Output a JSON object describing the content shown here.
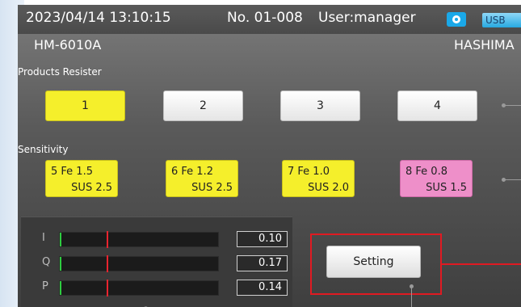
{
  "status_bar": {
    "datetime": "2023/04/14 13:10:15",
    "number": "No. 01-008",
    "user": "User:manager",
    "camera_icon": "camera-icon",
    "usb_label": "USB"
  },
  "header": {
    "model": "HM-6010A",
    "maker": "HASHIMA"
  },
  "products": {
    "title": "Products Resister",
    "buttons": [
      {
        "label": "1",
        "selected": true
      },
      {
        "label": "2",
        "selected": false
      },
      {
        "label": "3",
        "selected": false
      },
      {
        "label": "4",
        "selected": false
      }
    ]
  },
  "sensitivity": {
    "title": "Sensitivity",
    "items": [
      {
        "row1": "5  Fe   1.5",
        "row2": "SUS  2.5",
        "color": "#f5ef2b"
      },
      {
        "row1": "6  Fe   1.2",
        "row2": "SUS  2.5",
        "color": "#f5ef2b"
      },
      {
        "row1": "7  Fe   1.0",
        "row2": "SUS  2.0",
        "color": "#f5ef2b"
      },
      {
        "row1": "8  Fe   0.8",
        "row2": "SUS  1.5",
        "color": "#ee8fc9"
      }
    ]
  },
  "meters": [
    {
      "label": "I",
      "value": "0.10"
    },
    {
      "label": "Q",
      "value": "0.17"
    },
    {
      "label": "P",
      "value": "0.14"
    }
  ],
  "setting": {
    "label": "Setting",
    "highlight_color": "#e01a22"
  }
}
